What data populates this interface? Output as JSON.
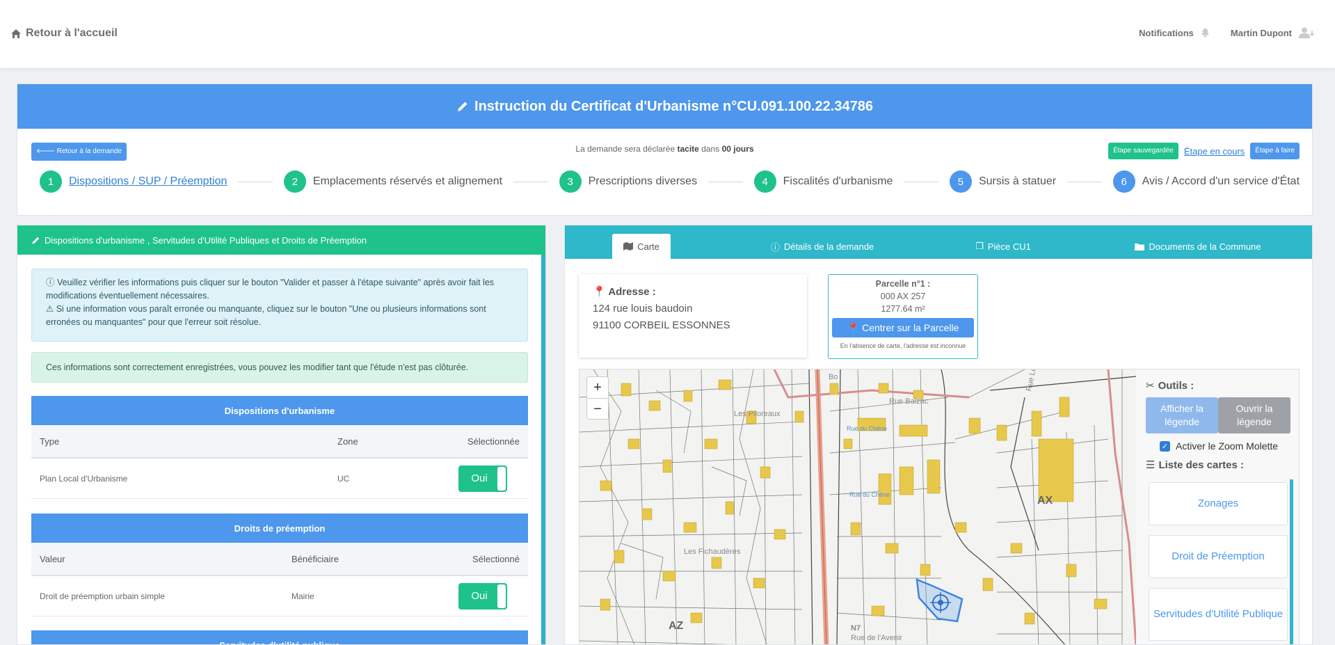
{
  "nav": {
    "home": "Retour à l'accueil",
    "notifications": "Notifications",
    "user": "Martin Dupont"
  },
  "wizard": {
    "title": "Instruction du Certificat d'Urbanisme n°CU.091.100.22.34786",
    "back_button": "Retour à la demande",
    "deadline_prefix": "La demande sera déclarée",
    "deadline_tacit": "tacite",
    "deadline_mid": "dans",
    "deadline_days": "00 jours",
    "legend_saved": "Étape sauvegardée",
    "legend_current": "Étape en cours",
    "legend_todo": "Étape à faire",
    "steps": [
      {
        "num": "1",
        "label": "Dispositions / SUP / Préemption",
        "state": "current"
      },
      {
        "num": "2",
        "label": "Emplacements réservés et alignement",
        "state": "saved"
      },
      {
        "num": "3",
        "label": "Prescriptions diverses",
        "state": "saved"
      },
      {
        "num": "4",
        "label": "Fiscalités d'urbanisme",
        "state": "saved"
      },
      {
        "num": "5",
        "label": "Sursis à statuer",
        "state": "todo"
      },
      {
        "num": "6",
        "label": "Avis / Accord d'un service d'État",
        "state": "todo"
      }
    ]
  },
  "left": {
    "header": "Dispositions d'urbanisme , Servitudes d'Utilité Publiques et Droits de Préemption",
    "info_line1": "Veuillez vérifier les informations puis cliquer sur le bouton \"Valider et passer à l'étape suivante\" après avoir fait les modifications éventuellement nécessaires.",
    "info_line2": "Si une information vous paraît erronée ou manquante, cliquez sur le bouton \"Une ou plusieurs informations sont erronées ou manquantes\" pour que l'erreur soit résolue.",
    "success": "Ces informations sont correctement enregistrées, vous pouvez les modifier tant que l'étude n'est pas clôturée.",
    "dispositions": {
      "title": "Dispositions d'urbanisme",
      "col_type": "Type",
      "col_zone": "Zone",
      "col_selected": "Sélectionnée",
      "row_type": "Plan Local d'Urbanisme",
      "row_zone": "UC",
      "row_toggle": "Oui"
    },
    "preemption": {
      "title": "Droits de préemption",
      "col_value": "Valeur",
      "col_benef": "Bénéficiaire",
      "col_selected": "Sélectionné",
      "row_value": "Droit de préemption urbain simple",
      "row_benef": "Mairie",
      "row_toggle": "Oui"
    },
    "sup_title": "Servitudes d'utilité publique"
  },
  "right": {
    "tabs": [
      "Carte",
      "Détails de la demande",
      "Pièce CU1",
      "Documents de la Commune"
    ],
    "address_title": "Adresse :",
    "address_line1": "124 rue louis baudoin",
    "address_line2": "91100 CORBEIL ESSONNES",
    "parcel_title": "Parcelle n°1 :",
    "parcel_ref": "000 AX 257",
    "parcel_area": "1277.64 m²",
    "parcel_button": "Centrer sur la Parcelle",
    "parcel_note": "En l'absence de carte, l'adresse est inconnue",
    "map_labels": {
      "piloreaux": "Les Piloreaux",
      "fichauderes": "Les Fichaudères",
      "rue_balzac": "Rue Balzac",
      "rue_louis_baudoin": "Rue Louis Baudoin",
      "ax": "AX",
      "az": "AZ",
      "n7": "N7",
      "rue_avenir": "Rue de l'Avenir",
      "bo": "Bo",
      "rue_du_chene": "Rue du Chêne"
    },
    "tools": {
      "title": "Outils :",
      "show_legend": "Afficher la légende",
      "open_legend": "Ouvrir la légende",
      "zoom_wheel": "Activer le Zoom Molette",
      "maps_title": "Liste des cartes :",
      "maps": [
        "Zonages",
        "Droit de Préemption",
        "Servitudes d'Utilité Publique"
      ]
    }
  },
  "colors": {
    "primary": "#4d97ec",
    "success": "#1fc28a",
    "teal": "#2eb8c9"
  }
}
